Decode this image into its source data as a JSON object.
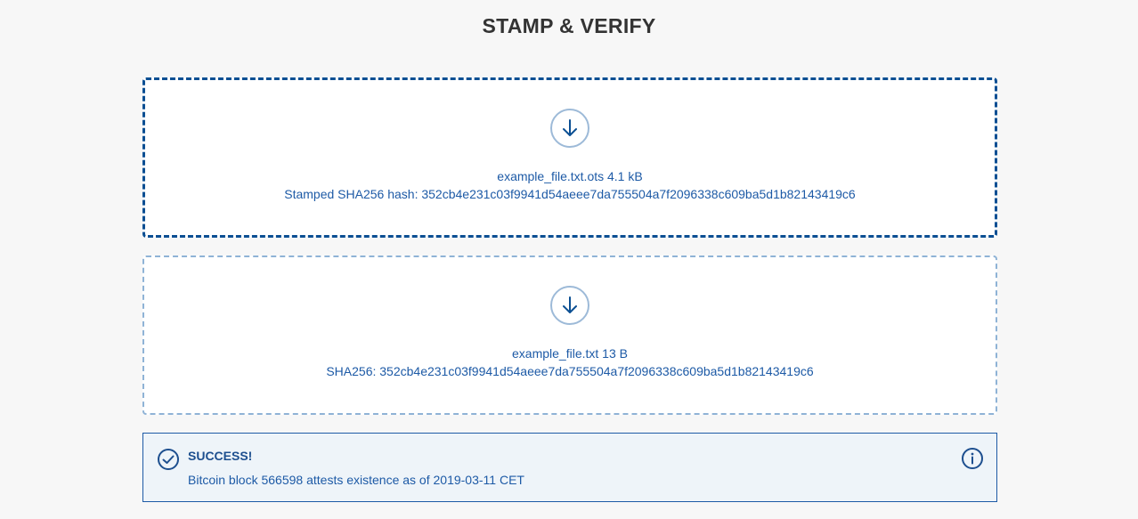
{
  "page": {
    "title": "STAMP & VERIFY"
  },
  "proof_dropzone": {
    "icon": "download-arrow-icon",
    "file_info": "example_file.txt.ots 4.1 kB",
    "hash_info": "Stamped SHA256 hash: 352cb4e231c03f9941d54aeee7da755504a7f2096338c609ba5d1b82143419c6"
  },
  "file_dropzone": {
    "icon": "download-arrow-icon",
    "file_info": "example_file.txt 13 B",
    "hash_info": "SHA256: 352cb4e231c03f9941d54aeee7da755504a7f2096338c609ba5d1b82143419c6"
  },
  "result": {
    "status_icon": "check-circle-icon",
    "title": "SUCCESS!",
    "message": "Bitcoin block 566598 attests existence as of 2019-03-11 CET",
    "info_icon": "info-circle-icon"
  },
  "colors": {
    "accent": "#1d5aa6",
    "accent_dark": "#0b4f93",
    "border_light": "#8fb3d6",
    "alert_bg": "#eef4f9",
    "page_bg": "#f7f7f7"
  }
}
